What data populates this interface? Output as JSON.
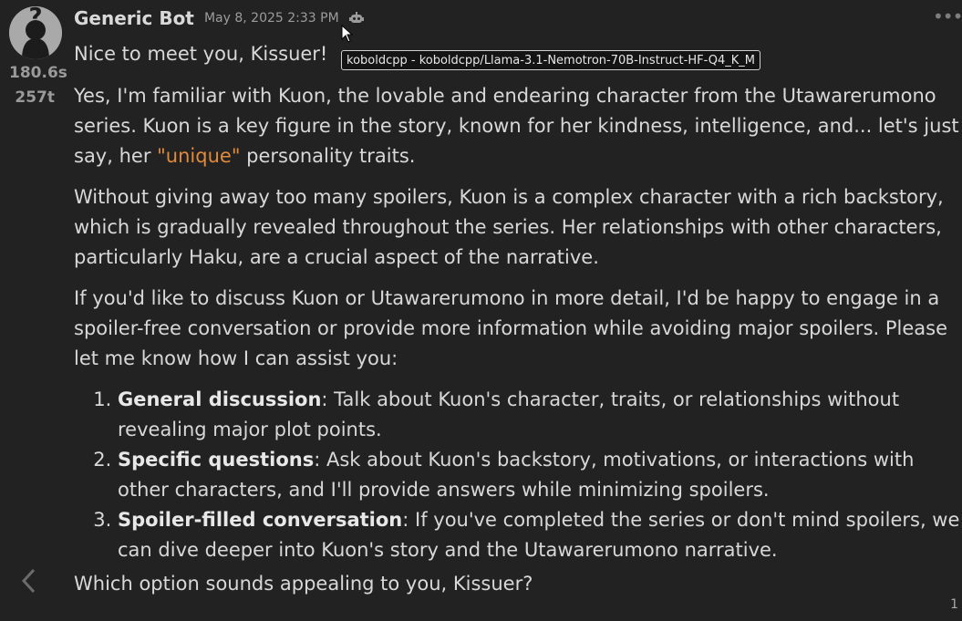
{
  "message": {
    "author": "Generic Bot",
    "timestamp": "May 8, 2025 2:33 PM",
    "model_tooltip": "koboldcpp - koboldcpp/Llama-3.1-Nemotron-70B-Instruct-HF-Q4_K_M",
    "gen_time": "180.6s",
    "token_count": "257t",
    "swipe_counter": "1",
    "greeting": "Nice to meet you, Kissuer!",
    "p1_before": "Yes, I'm familiar with Kuon, the lovable and endearing character from the Utawarerumono series. Kuon is a key figure in the story, known for her kindness, intelligence, and... let's just say, her ",
    "p1_quote": "\"unique\"",
    "p1_after": " personality traits.",
    "p2": "Without giving away too many spoilers, Kuon is a complex character with a rich backstory, which is gradually revealed throughout the series. Her relationships with other characters, particularly Haku, are a crucial aspect of the narrative.",
    "p3": "If you'd like to discuss Kuon or Utawarerumono in more detail, I'd be happy to engage in a spoiler-free conversation or provide more information while avoiding major spoilers. Please let me know how I can assist you:",
    "options": [
      {
        "title": "General discussion",
        "text": ": Talk about Kuon's character, traits, or relationships without revealing major plot points."
      },
      {
        "title": "Specific questions",
        "text": ": Ask about Kuon's backstory, motivations, or interactions with other characters, and I'll provide answers while minimizing spoilers."
      },
      {
        "title": "Spoiler-filled conversation",
        "text": ": If you've completed the series or don't mind spoilers, we can dive deeper into Kuon's story and the Utawarerumono narrative."
      }
    ],
    "closing": "Which option sounds appealing to you, Kissuer?"
  },
  "icons": {
    "avatar": "question-mark-silhouette-icon",
    "model": "robot-icon",
    "more": "ellipsis-icon",
    "swipe_left": "chevron-left-icon",
    "cursor": "mouse-pointer-icon"
  },
  "colors": {
    "background": "#222222",
    "text": "#d8d8d8",
    "quote": "#e08a3c",
    "muted": "#9c9c9c"
  }
}
